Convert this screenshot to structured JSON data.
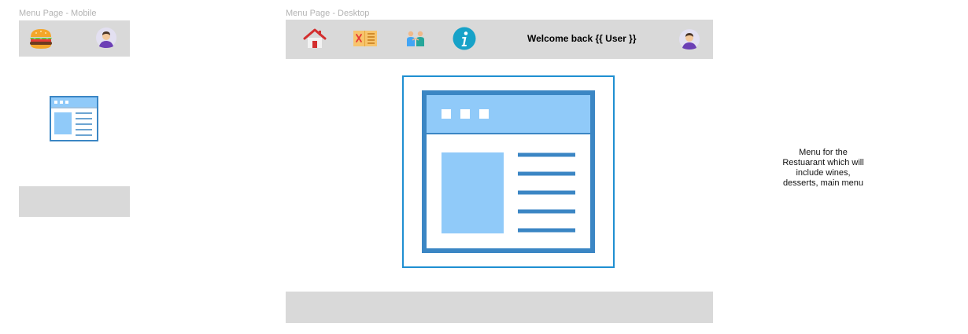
{
  "mobile": {
    "frame_label": "Menu Page - Mobile",
    "header": {
      "logo_icon": "burger-icon",
      "avatar_icon": "user-avatar-icon"
    },
    "content": {
      "icon": "menu-webpage-icon"
    },
    "footer": {
      "label": ""
    }
  },
  "desktop": {
    "frame_label": "Menu Page - Desktop",
    "nav": [
      {
        "name": "home",
        "icon": "house-icon"
      },
      {
        "name": "menu",
        "icon": "restaurant-menu-icon"
      },
      {
        "name": "people",
        "icon": "people-icon"
      },
      {
        "name": "info",
        "icon": "info-icon"
      }
    ],
    "welcome_text": "Welcome back {{ User }}",
    "avatar_icon": "user-avatar-icon",
    "content": {
      "icon": "menu-webpage-icon"
    },
    "footer": {
      "label": ""
    }
  },
  "note": {
    "lines": [
      "Menu for the",
      "Restuarant which will",
      "include wines,",
      "desserts, main menu"
    ]
  },
  "colors": {
    "bar_gray": "#d9d9d9",
    "accent_blue": "#1f8fd1",
    "window_blue": "#3b86c4",
    "window_light": "#90caf9"
  }
}
